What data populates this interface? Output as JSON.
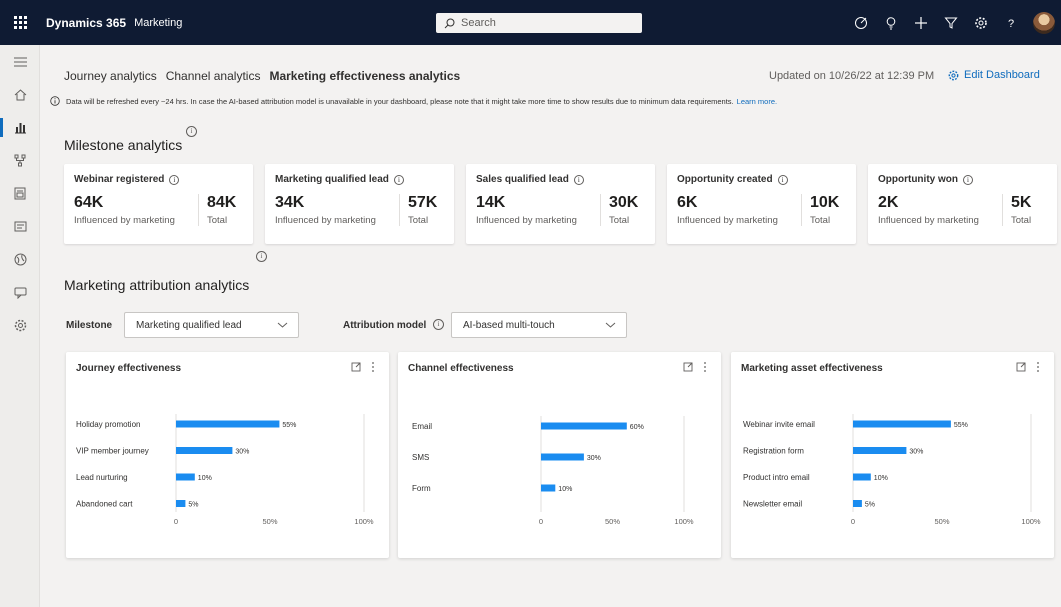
{
  "topbar": {
    "brand": "Dynamics 365",
    "app": "Marketing",
    "search_placeholder": "Search",
    "icons": [
      "waffle-icon",
      "target-icon",
      "lightbulb-icon",
      "plus-icon",
      "filter-icon",
      "gear-icon",
      "help-icon",
      "avatar"
    ]
  },
  "rail": {
    "items": [
      "menu-icon",
      "home-icon",
      "analytics-icon",
      "journey-icon",
      "form-icon",
      "email-icon",
      "globe-icon",
      "chat-icon",
      "settings-icon"
    ],
    "active_index": 2
  },
  "tabs": [
    {
      "label": "Journey analytics"
    },
    {
      "label": "Channel analytics"
    },
    {
      "label": "Marketing effectiveness analytics"
    }
  ],
  "updated": "Updated on 10/26/22 at 12:39 PM",
  "edit_dashboard": "Edit Dashboard",
  "info": {
    "text": "Data will be refreshed every ~24 hrs. In case the AI-based attribution model is unavailable in your dashboard, please note that it might take more time to show results due to minimum data requirements.",
    "link": "Learn more."
  },
  "milestone": {
    "title": "Milestone analytics",
    "cards": [
      {
        "title": "Webinar registered",
        "influenced": "64K",
        "influenced_label": "Influenced by marketing",
        "total": "84K",
        "total_label": "Total"
      },
      {
        "title": "Marketing qualified lead",
        "influenced": "34K",
        "influenced_label": "Influenced by marketing",
        "total": "57K",
        "total_label": "Total"
      },
      {
        "title": "Sales qualified lead",
        "influenced": "14K",
        "influenced_label": "Influenced by marketing",
        "total": "30K",
        "total_label": "Total"
      },
      {
        "title": "Opportunity created",
        "influenced": "6K",
        "influenced_label": "Influenced by marketing",
        "total": "10K",
        "total_label": "Total"
      },
      {
        "title": "Opportunity won",
        "influenced": "2K",
        "influenced_label": "Influenced by marketing",
        "total": "5K",
        "total_label": "Total"
      }
    ]
  },
  "attribution": {
    "title": "Marketing attribution analytics",
    "milestone_label": "Milestone",
    "milestone_value": "Marketing qualified lead",
    "model_label": "Attribution model",
    "model_value": "AI-based multi-touch"
  },
  "colors": {
    "bar": "#1a8cf0",
    "topbar": "#0f1b33",
    "accent": "#0f6cbd"
  },
  "chart_data": [
    {
      "type": "bar",
      "title": "Journey effectiveness",
      "categories": [
        "Holiday promotion",
        "VIP member journey",
        "Lead nurturing",
        "Abandoned cart"
      ],
      "values": [
        55,
        30,
        10,
        5
      ],
      "xticks": [
        "0",
        "50%",
        "100%"
      ],
      "xlim": [
        0,
        100
      ]
    },
    {
      "type": "bar",
      "title": "Channel effectiveness",
      "categories": [
        "Email",
        "SMS",
        "Form"
      ],
      "values": [
        60,
        30,
        10
      ],
      "xticks": [
        "0",
        "50%",
        "100%"
      ],
      "xlim": [
        0,
        100
      ]
    },
    {
      "type": "bar",
      "title": "Marketing asset effectiveness",
      "categories": [
        "Webinar invite email",
        "Registration form",
        "Product intro email",
        "Newsletter email"
      ],
      "values": [
        55,
        30,
        10,
        5
      ],
      "xticks": [
        "0",
        "50%",
        "100%"
      ],
      "xlim": [
        0,
        100
      ]
    }
  ]
}
